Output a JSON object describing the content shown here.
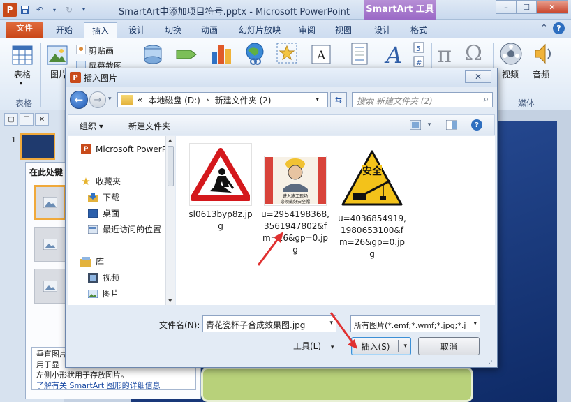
{
  "window": {
    "title": "SmartArt中添加项目符号.pptx - Microsoft PowerPoint",
    "context_tab": "SmartArt 工具",
    "controls": {
      "minimize": "–",
      "maximize": "☐",
      "close": "✕"
    }
  },
  "ribbon_tabs": [
    "文件",
    "开始",
    "插入",
    "设计",
    "切换",
    "动画",
    "幻灯片放映",
    "审阅",
    "视图",
    "设计",
    "格式"
  ],
  "ribbon_tabs_active": "插入",
  "ribbon": {
    "table": "表格",
    "picture": "图片",
    "clipart": "剪贴画",
    "screenshot": "屏幕截图",
    "video": "视频",
    "audio": "音频",
    "group_table": "表格",
    "group_media": "媒体",
    "symbols": [
      "π",
      "Ω"
    ]
  },
  "thumb_pane": {
    "slide_number": "1"
  },
  "smartart_pane": {
    "heading": "在此处键",
    "desc_lines": [
      "垂直图片",
      "用于显",
      "左侧小形状用于存放图片。"
    ],
    "link": "了解有关 SmartArt 图形的详细信息"
  },
  "dialog": {
    "title": "插入图片",
    "close": "✕",
    "address": [
      "«",
      "本地磁盘 (D:)",
      "›",
      "新建文件夹 (2)"
    ],
    "search_placeholder": "搜索 新建文件夹 (2)",
    "toolbar": {
      "organize": "组织 ▾",
      "new_folder": "新建文件夹"
    },
    "nav_items": [
      {
        "label": "Microsoft PowerP",
        "icon": "ppt-icon"
      },
      {
        "label": "收藏夹",
        "icon": "star-icon"
      },
      {
        "label": "下载",
        "icon": "download-icon"
      },
      {
        "label": "桌面",
        "icon": "desktop-icon"
      },
      {
        "label": "最近访问的位置",
        "icon": "recent-icon"
      },
      {
        "label": "库",
        "icon": "library-icon"
      },
      {
        "label": "视频",
        "icon": "video-icon"
      },
      {
        "label": "图片",
        "icon": "pictures-icon"
      }
    ],
    "files": [
      {
        "name_lines": [
          "sl0613byp8z.jp",
          "g"
        ],
        "thumb": "road-work-sign"
      },
      {
        "name_lines": [
          "u=2954198368,",
          "3561947802&f",
          "m=26&gp=0.jp",
          "g"
        ],
        "thumb": "worker-poster"
      },
      {
        "name_lines": [
          "u=4036854919,",
          "1980653100&f",
          "m=26&gp=0.jp",
          "g"
        ],
        "thumb": "safety-crane-sign"
      }
    ],
    "worker_poster_text": [
      "进入施工现场",
      "必须戴好安全帽"
    ],
    "safety_sign_text": "安全",
    "filename_label": "文件名(N):",
    "filename_value": "青花瓷杯子合成效果图.jpg",
    "filetype_value": "所有图片(*.emf;*.wmf;*.jpg;*.j",
    "tools": "工具(L)",
    "insert": "插入(S)",
    "cancel": "取消"
  }
}
